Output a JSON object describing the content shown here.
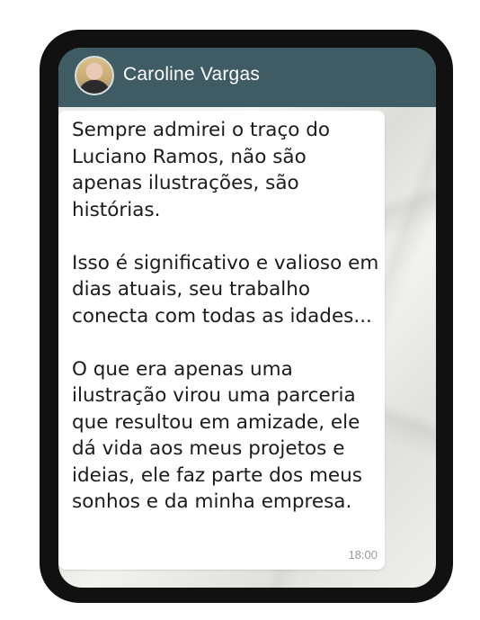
{
  "chat": {
    "contact_name": "Caroline Vargas",
    "avatar_icon": "avatar-photo",
    "header_color": "#3f5b63"
  },
  "message": {
    "paragraphs": [
      "Sempre admirei o traço do Luciano Ramos, não são apenas ilustrações, são histórias.",
      "Isso é significativo e valioso em dias atuais, seu trabalho conecta com todas as idades...",
      "O que era apenas uma ilustração virou uma parceria que resultou em amizade, ele dá vida aos meus projetos e ideias, ele faz parte dos meus sonhos e da minha empresa."
    ],
    "time": "18:00"
  }
}
